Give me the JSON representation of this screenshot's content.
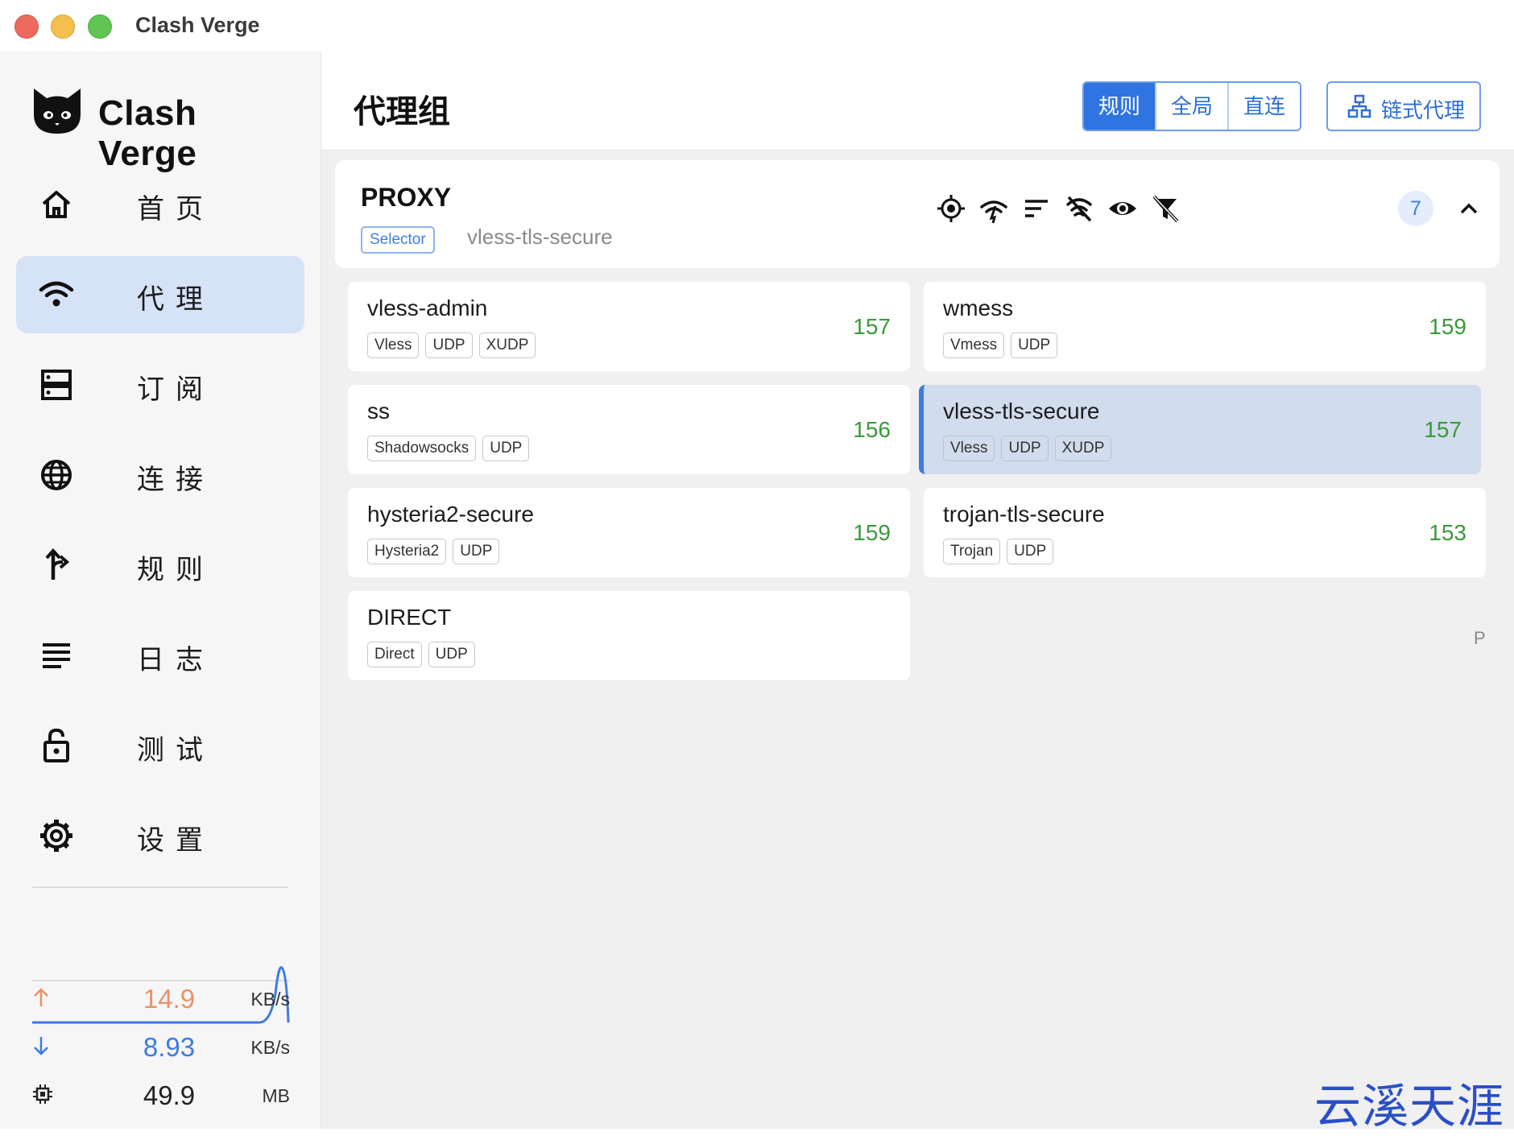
{
  "window": {
    "title": "Clash Verge"
  },
  "sidebar": {
    "brand": "Clash Verge",
    "items": [
      {
        "label": "首页",
        "icon": "home-icon",
        "active": false
      },
      {
        "label": "代理",
        "icon": "wifi-icon",
        "active": true
      },
      {
        "label": "订阅",
        "icon": "server-icon",
        "active": false
      },
      {
        "label": "连接",
        "icon": "globe-icon",
        "active": false
      },
      {
        "label": "规则",
        "icon": "route-icon",
        "active": false
      },
      {
        "label": "日志",
        "icon": "list-icon",
        "active": false
      },
      {
        "label": "测试",
        "icon": "lock-open-icon",
        "active": false
      },
      {
        "label": "设置",
        "icon": "gear-icon",
        "active": false
      }
    ],
    "traffic": {
      "upload": {
        "value": "14.9",
        "unit": "KB/s",
        "color": "#e9916a"
      },
      "download": {
        "value": "8.93",
        "unit": "KB/s",
        "color": "#3d7be0"
      },
      "memory": {
        "value": "49.9",
        "unit": "MB"
      }
    }
  },
  "header": {
    "title": "代理组",
    "modes": [
      {
        "label": "规则",
        "active": true
      },
      {
        "label": "全局",
        "active": false
      },
      {
        "label": "直连",
        "active": false
      }
    ],
    "chain_label": "链式代理"
  },
  "group": {
    "name": "PROXY",
    "type": "Selector",
    "now": "vless-tls-secure",
    "count": "7",
    "toolbar_icons": [
      "locate-icon",
      "delay-test-icon",
      "sort-icon",
      "filter-unavailable-icon",
      "eye-icon",
      "filter-off-icon",
      "collapse-icon"
    ]
  },
  "proxies": [
    {
      "name": "vless-admin",
      "tags": [
        "Vless",
        "UDP",
        "XUDP"
      ],
      "delay": "157",
      "selected": false
    },
    {
      "name": "wmess",
      "tags": [
        "Vmess",
        "UDP"
      ],
      "delay": "159",
      "selected": false
    },
    {
      "name": "ss",
      "tags": [
        "Shadowsocks",
        "UDP"
      ],
      "delay": "156",
      "selected": false
    },
    {
      "name": "vless-tls-secure",
      "tags": [
        "Vless",
        "UDP",
        "XUDP"
      ],
      "delay": "157",
      "selected": true
    },
    {
      "name": "hysteria2-secure",
      "tags": [
        "Hysteria2",
        "UDP"
      ],
      "delay": "159",
      "selected": false
    },
    {
      "name": "trojan-tls-secure",
      "tags": [
        "Trojan",
        "UDP"
      ],
      "delay": "153",
      "selected": false
    },
    {
      "name": "DIRECT",
      "tags": [
        "Direct",
        "UDP"
      ],
      "delay": "",
      "selected": false
    }
  ],
  "scroll_letter": "P",
  "watermark": "云溪天涯"
}
